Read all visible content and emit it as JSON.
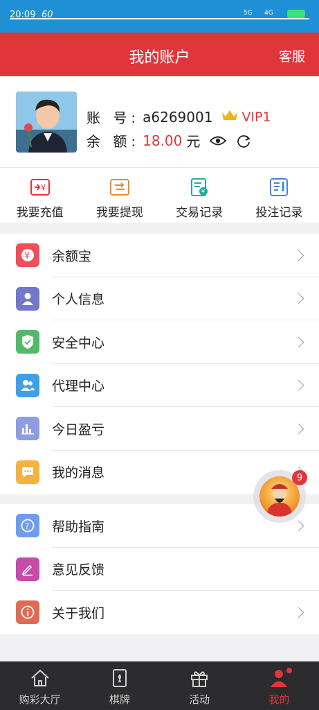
{
  "status_bar": {
    "time": "20:09",
    "network_speed": "60",
    "signal_a": "5G",
    "signal_b": "4G"
  },
  "header": {
    "title": "我的账户",
    "service_label": "客服"
  },
  "profile": {
    "account_label": "账 号:",
    "account_value": "a6269001",
    "vip_level": "VIP1",
    "balance_label": "余 额:",
    "balance_value": "18.00",
    "currency": "元"
  },
  "actions": [
    {
      "label": "我要充值",
      "icon": "recharge-icon"
    },
    {
      "label": "我要提现",
      "icon": "withdraw-icon"
    },
    {
      "label": "交易记录",
      "icon": "transaction-record-icon"
    },
    {
      "label": "投注记录",
      "icon": "bet-record-icon"
    }
  ],
  "menu_group1": [
    {
      "label": "余额宝",
      "icon": "yen-icon",
      "color": "#ef4e5a"
    },
    {
      "label": "个人信息",
      "icon": "person-icon",
      "color": "#6f78c9"
    },
    {
      "label": "安全中心",
      "icon": "shield-icon",
      "color": "#53b96a"
    },
    {
      "label": "代理中心",
      "icon": "people-icon",
      "color": "#3fa0e8"
    },
    {
      "label": "今日盈亏",
      "icon": "bar-chart-icon",
      "color": "#8e9de0"
    },
    {
      "label": "我的消息",
      "icon": "message-icon",
      "color": "#f5b33c"
    }
  ],
  "menu_group2": [
    {
      "label": "帮助指南",
      "icon": "help-icon",
      "color": "#6e9df0"
    },
    {
      "label": "意见反馈",
      "icon": "feedback-icon",
      "color": "#c84aa9"
    },
    {
      "label": "关于我们",
      "icon": "info-icon",
      "color": "#e06b54"
    }
  ],
  "floating_badge_count": "9",
  "bottom_nav": [
    {
      "label": "购彩大厅",
      "icon": "home-icon",
      "active": false
    },
    {
      "label": "棋牌",
      "icon": "cards-icon",
      "active": false
    },
    {
      "label": "活动",
      "icon": "gift-icon",
      "active": false
    },
    {
      "label": "我的",
      "icon": "user-icon",
      "active": true
    }
  ],
  "colors": {
    "brand_red": "#e0363b",
    "status_bar_blue": "#1f8fd6",
    "nav_background": "#2c2c2e"
  }
}
